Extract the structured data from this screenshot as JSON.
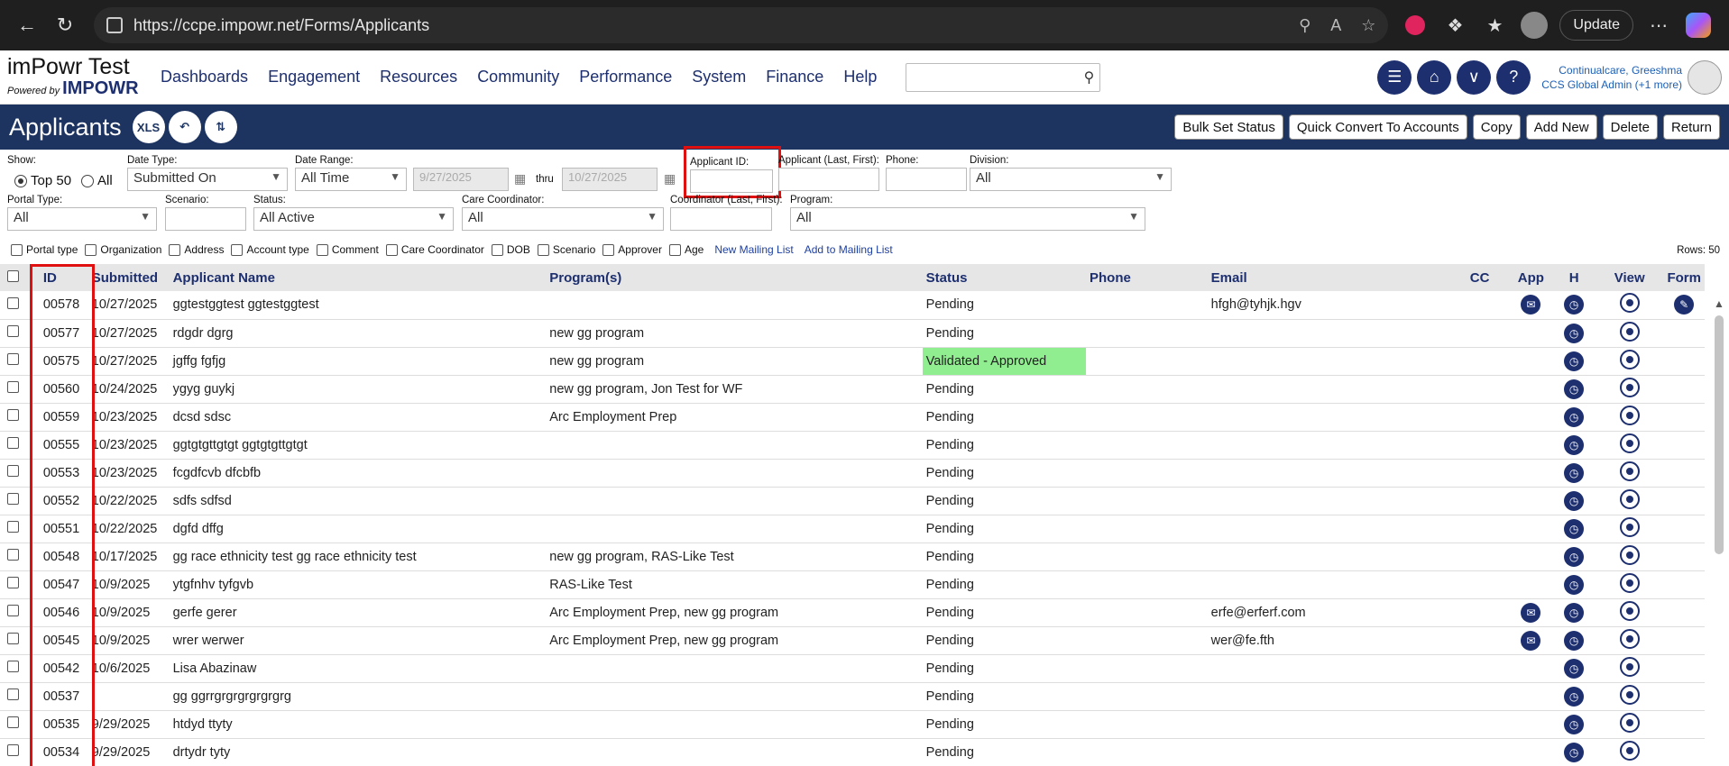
{
  "browser": {
    "url": "https://ccpe.impowr.net/Forms/Applicants",
    "update_label": "Update"
  },
  "header": {
    "logo_title": "imPowr Test",
    "logo_powered": "Powered by",
    "logo_brand": "IMPOWR",
    "menu": [
      "Dashboards",
      "Engagement",
      "Resources",
      "Community",
      "Performance",
      "System",
      "Finance",
      "Help"
    ],
    "search_value": "",
    "user_name": "Continualcare, Greeshma",
    "user_role": "CCS Global Admin (+1 more)"
  },
  "titlebar": {
    "title": "Applicants",
    "xls_label": "XLS",
    "buttons": [
      "Bulk Set Status",
      "Quick Convert To Accounts",
      "Copy",
      "Add New",
      "Delete",
      "Return"
    ]
  },
  "filters": {
    "show_label": "Show:",
    "top50_label": "Top 50",
    "all_label": "All",
    "date_type_label": "Date Type:",
    "date_type_value": "Submitted On",
    "date_range_label": "Date Range:",
    "date_range_value": "All Time",
    "date_from": "9/27/2025",
    "thru_label": "thru",
    "date_to": "10/27/2025",
    "applicant_id_label": "Applicant ID:",
    "applicant_name_label": "Applicant (Last, First):",
    "phone_label": "Phone:",
    "division_label": "Division:",
    "division_value": "All",
    "portal_type_label": "Portal Type:",
    "portal_type_value": "All",
    "scenario_label": "Scenario:",
    "status_label": "Status:",
    "status_value": "All Active",
    "care_coord_label": "Care Coordinator:",
    "care_coord_value": "All",
    "coord_name_label": "Coordinator (Last, First):",
    "program_label": "Program:",
    "program_value": "All",
    "columns": [
      "Portal type",
      "Organization",
      "Address",
      "Account type",
      "Comment",
      "Care Coordinator",
      "DOB",
      "Scenario",
      "Approver",
      "Age"
    ],
    "new_mailing_list": "New Mailing List",
    "add_mailing_list": "Add to Mailing List",
    "rows_label": "Rows: 50"
  },
  "table": {
    "headers": {
      "id": "ID",
      "submitted": "Submitted",
      "name": "Applicant Name",
      "programs": "Program(s)",
      "status": "Status",
      "phone": "Phone",
      "email": "Email",
      "cc": "CC",
      "app": "App",
      "h": "H",
      "view": "View",
      "form": "Form"
    },
    "rows": [
      {
        "id": "00578",
        "submitted": "10/27/2025",
        "name": "ggtestggtest ggtestggtest",
        "programs": "",
        "status": "Pending",
        "email": "hfgh@tyhjk.hgv",
        "app": true,
        "form": true
      },
      {
        "id": "00577",
        "submitted": "10/27/2025",
        "name": "rdgdr dgrg",
        "programs": "new gg program",
        "status": "Pending",
        "email": "",
        "app": false,
        "form": false
      },
      {
        "id": "00575",
        "submitted": "10/27/2025",
        "name": "jgffg fgfjg",
        "programs": "new gg program",
        "status": "Validated - Approved",
        "email": "",
        "app": false,
        "form": false,
        "approved": true
      },
      {
        "id": "00560",
        "submitted": "10/24/2025",
        "name": "ygyg guykj",
        "programs": "new gg program, Jon Test for WF",
        "status": "Pending",
        "email": "",
        "app": false,
        "form": false
      },
      {
        "id": "00559",
        "submitted": "10/23/2025",
        "name": "dcsd sdsc",
        "programs": "Arc Employment Prep",
        "status": "Pending",
        "email": "",
        "app": false,
        "form": false
      },
      {
        "id": "00555",
        "submitted": "10/23/2025",
        "name": "ggtgtgttgtgt ggtgtgttgtgt",
        "programs": "",
        "status": "Pending",
        "email": "",
        "app": false,
        "form": false
      },
      {
        "id": "00553",
        "submitted": "10/23/2025",
        "name": "fcgdfcvb dfcbfb",
        "programs": "",
        "status": "Pending",
        "email": "",
        "app": false,
        "form": false
      },
      {
        "id": "00552",
        "submitted": "10/22/2025",
        "name": "sdfs sdfsd",
        "programs": "",
        "status": "Pending",
        "email": "",
        "app": false,
        "form": false
      },
      {
        "id": "00551",
        "submitted": "10/22/2025",
        "name": "dgfd dffg",
        "programs": "",
        "status": "Pending",
        "email": "",
        "app": false,
        "form": false
      },
      {
        "id": "00548",
        "submitted": "10/17/2025",
        "name": "gg race ethnicity test gg race ethnicity test",
        "programs": "new gg program, RAS-Like Test",
        "status": "Pending",
        "email": "",
        "app": false,
        "form": false
      },
      {
        "id": "00547",
        "submitted": "10/9/2025",
        "name": "ytgfnhv tyfgvb",
        "programs": "RAS-Like Test",
        "status": "Pending",
        "email": "",
        "app": false,
        "form": false
      },
      {
        "id": "00546",
        "submitted": "10/9/2025",
        "name": "gerfe gerer",
        "programs": "Arc Employment Prep, new gg program",
        "status": "Pending",
        "email": "erfe@erferf.com",
        "app": true,
        "form": false
      },
      {
        "id": "00545",
        "submitted": "10/9/2025",
        "name": "wrer werwer",
        "programs": "Arc Employment Prep, new gg program",
        "status": "Pending",
        "email": "wer@fe.fth",
        "app": true,
        "form": false
      },
      {
        "id": "00542",
        "submitted": "10/6/2025",
        "name": "Lisa Abazinaw",
        "programs": "",
        "status": "Pending",
        "email": "",
        "app": false,
        "form": false
      },
      {
        "id": "00537",
        "submitted": "",
        "name": "gg ggrrgrgrgrgrgrgrg",
        "programs": "",
        "status": "Pending",
        "email": "",
        "app": false,
        "form": false
      },
      {
        "id": "00535",
        "submitted": "9/29/2025",
        "name": "htdyd ttyty",
        "programs": "",
        "status": "Pending",
        "email": "",
        "app": false,
        "form": false
      },
      {
        "id": "00534",
        "submitted": "9/29/2025",
        "name": "drtydr tyty",
        "programs": "",
        "status": "Pending",
        "email": "",
        "app": false,
        "form": false
      }
    ]
  }
}
